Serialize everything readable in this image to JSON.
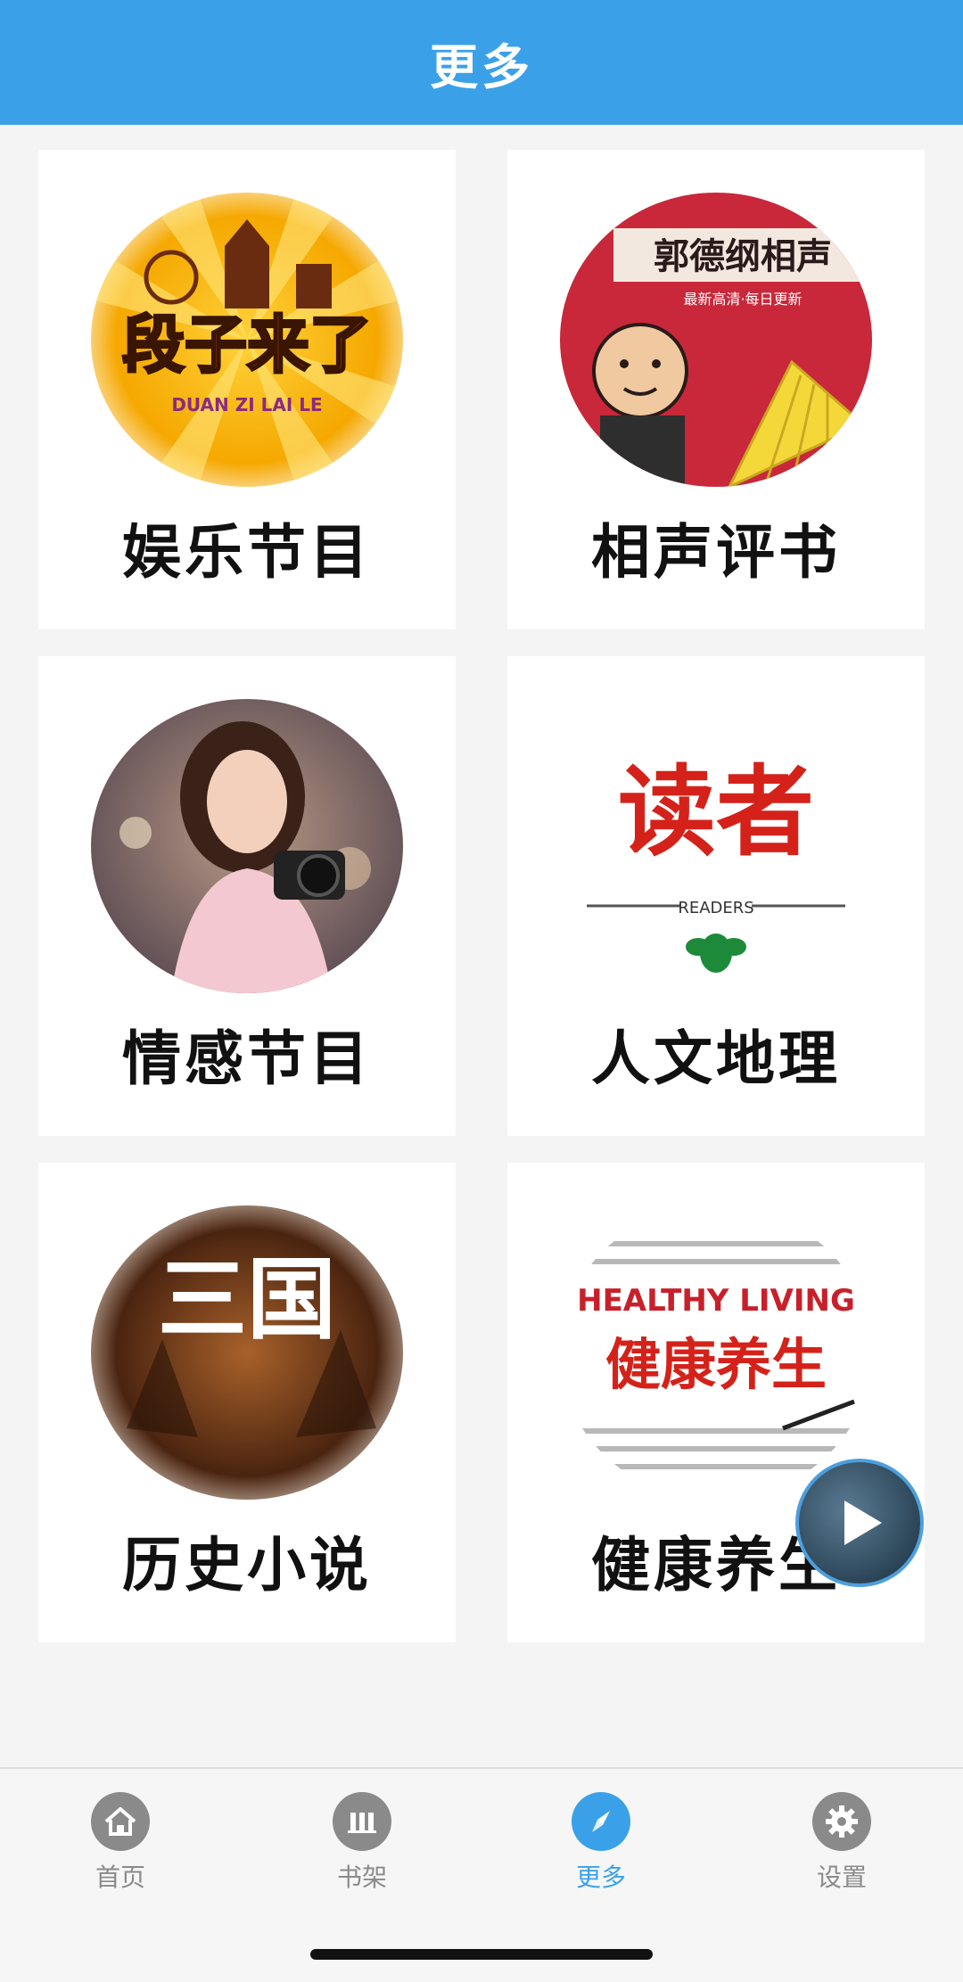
{
  "header": {
    "title": "更多"
  },
  "cards": [
    {
      "label": "娱乐节目",
      "thumb_text": "段子来了",
      "thumb_sub": "DUAN ZI LAI LE"
    },
    {
      "label": "相声评书",
      "thumb_text": "郭德纲相声",
      "thumb_sub": "最新高清·每日更新"
    },
    {
      "label": "情感节目"
    },
    {
      "label": "人文地理",
      "thumb_text": "读者",
      "thumb_sub": "READERS"
    },
    {
      "label": "历史小说",
      "thumb_text": "三国"
    },
    {
      "label": "健康养生",
      "thumb_text": "健康养生",
      "thumb_sub": "HEALTHY LIVING"
    }
  ],
  "tabbar": {
    "items": [
      {
        "label": "首页",
        "icon": "home-icon"
      },
      {
        "label": "书架",
        "icon": "bookshelf-icon"
      },
      {
        "label": "更多",
        "icon": "compass-icon",
        "active": true
      },
      {
        "label": "设置",
        "icon": "gear-icon"
      }
    ]
  },
  "colors": {
    "header_bg": "#3aa1e9",
    "active_tab": "#3aa1e9",
    "inactive_tab": "#8a8a8a"
  }
}
